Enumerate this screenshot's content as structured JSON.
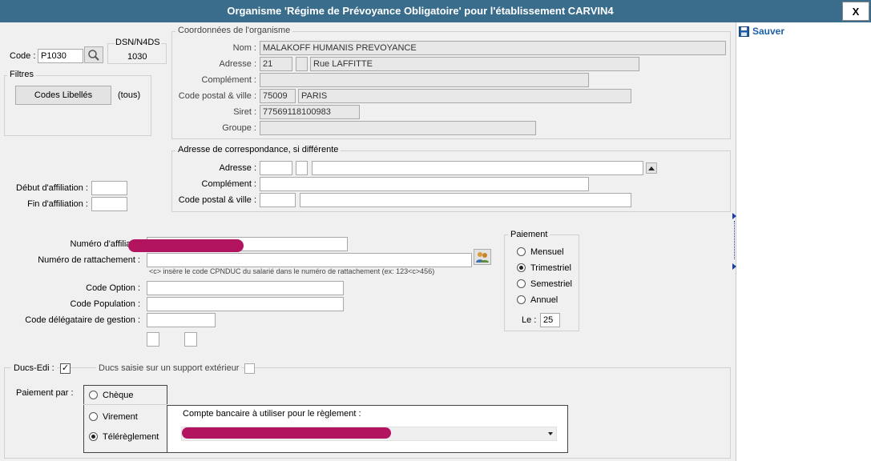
{
  "window": {
    "title": "Organisme 'Régime de Prévoyance Obligatoire' pour l'établissement CARVIN4",
    "close_label": "X"
  },
  "toolbar": {
    "save_label": "Sauver",
    "save_icon": "floppy-disk-icon"
  },
  "left": {
    "code_label": "Code :",
    "code_value": "P1030",
    "dsn_label": "DSN/N4DS",
    "dsn_value": "1030",
    "filters_title": "Filtres",
    "filter_button": "Codes Libellés",
    "filter_value": "(tous)",
    "debut_label": "Début d'affiliation :",
    "debut_value": "",
    "fin_label": "Fin d'affiliation :",
    "fin_value": ""
  },
  "org": {
    "title": "Coordonnées de l'organisme",
    "nom_label": "Nom :",
    "nom_value": "MALAKOFF HUMANIS PREVOYANCE",
    "adresse_label": "Adresse :",
    "adresse_num": "21",
    "adresse_bis": "",
    "adresse_rue": "Rue LAFFITTE",
    "complement_label": "Complément :",
    "complement_value": "",
    "cp_label": "Code postal & ville :",
    "cp_value": "75009",
    "ville_value": "PARIS",
    "siret_label": "Siret :",
    "siret_value": "77569118100983",
    "groupe_label": "Groupe :",
    "groupe_value": ""
  },
  "corresp": {
    "title": "Adresse de correspondance, si différente",
    "adresse_label": "Adresse :",
    "complement_label": "Complément :",
    "cp_label": "Code postal & ville :",
    "adresse_num": "",
    "adresse_bis": "",
    "adresse_rue": "",
    "complement_value": "",
    "cp_value": "",
    "ville_value": ""
  },
  "affil": {
    "numero_label": "Numéro d'affiliatio",
    "rattach_label": "Numéro de rattachement :",
    "hint": "<c> insère le code CPNDUC du salarié dans le numéro de rattachement (ex: 123<c>456)",
    "option_label": "Code Option :",
    "population_label": "Code Population :",
    "delegataire_label": "Code délégataire de gestion :"
  },
  "paiement": {
    "title": "Paiement",
    "options": [
      "Mensuel",
      "Trimestriel",
      "Semestriel",
      "Annuel"
    ],
    "selected": 1,
    "le_label": "Le :",
    "le_value": "25"
  },
  "ducs": {
    "label": "Ducs-Edi :",
    "checked": true,
    "support_label": "Ducs saisie sur un support extérieur",
    "paiement_par_label": "Paiement par :",
    "modes": [
      "Chèque",
      "Virement",
      "Télérèglement"
    ],
    "selected": 2,
    "compte_label": "Compte bancaire à utiliser pour le règlement :"
  },
  "colors": {
    "title_bar": "#3a6d8c",
    "accent": "#1f5fa8",
    "redaction": "#b3145f"
  }
}
